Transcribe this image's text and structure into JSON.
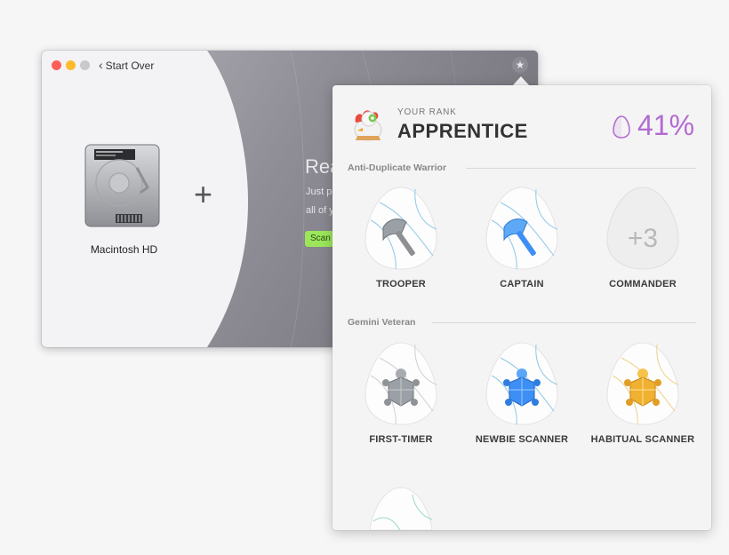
{
  "window": {
    "back_label": "Start Over",
    "disk_label": "Macintosh HD",
    "ready_text": "Rea",
    "desc_line1": "Just p",
    "desc_line2": "all of y",
    "scan_button": "Scan"
  },
  "rank": {
    "caption": "YOUR RANK",
    "name": "APPRENTICE",
    "progress": "41%"
  },
  "sections": [
    {
      "title": "Anti-Duplicate Warrior",
      "badges": [
        {
          "label": "TROOPER",
          "icon": "axe-icon"
        },
        {
          "label": "CAPTAIN",
          "icon": "axe-icon"
        },
        {
          "label": "COMMANDER",
          "icon": "locked-egg",
          "count": "+3"
        }
      ]
    },
    {
      "title": "Gemini Veteran",
      "badges": [
        {
          "label": "FIRST-TIMER",
          "icon": "turtle-icon"
        },
        {
          "label": "NEWBIE SCANNER",
          "icon": "turtle-icon"
        },
        {
          "label": "HABITUAL SCANNER",
          "icon": "turtle-icon"
        }
      ]
    }
  ],
  "colors": {
    "accent_purple": "#b36ad1",
    "scan_green": "#9be65b",
    "silver": "#9aa0a6",
    "blue": "#3d8ef5",
    "gold": "#f0b030"
  }
}
